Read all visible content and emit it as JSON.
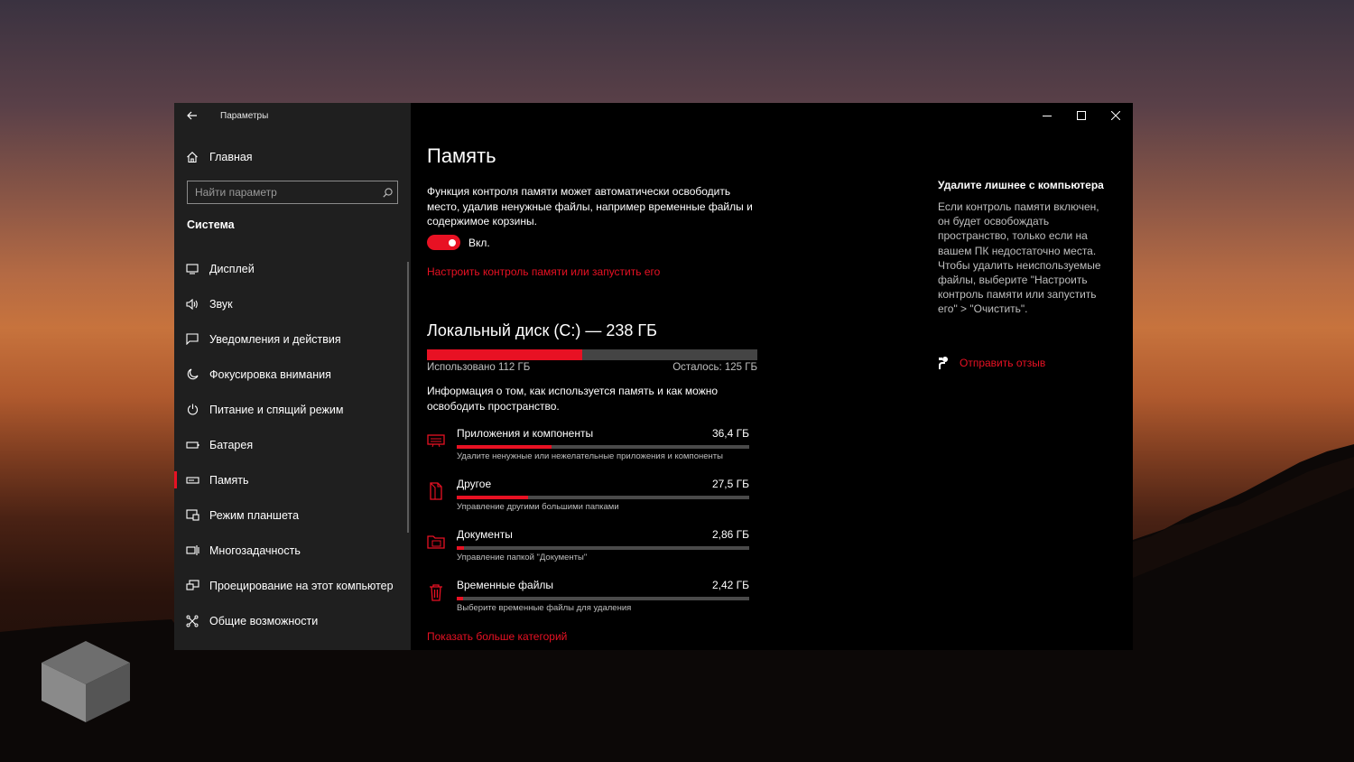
{
  "app_title": "Параметры",
  "sidebar": {
    "home_label": "Главная",
    "search_placeholder": "Найти параметр",
    "section_title": "Система",
    "items": [
      {
        "label": "Дисплей",
        "icon": "monitor-icon"
      },
      {
        "label": "Звук",
        "icon": "speaker-icon"
      },
      {
        "label": "Уведомления и действия",
        "icon": "notification-icon"
      },
      {
        "label": "Фокусировка внимания",
        "icon": "moon-icon"
      },
      {
        "label": "Питание и спящий режим",
        "icon": "power-icon"
      },
      {
        "label": "Батарея",
        "icon": "battery-icon"
      },
      {
        "label": "Память",
        "icon": "storage-icon",
        "active": true
      },
      {
        "label": "Режим планшета",
        "icon": "tablet-icon"
      },
      {
        "label": "Многозадачность",
        "icon": "multitasking-icon"
      },
      {
        "label": "Проецирование на этот компьютер",
        "icon": "projecting-icon"
      },
      {
        "label": "Общие возможности",
        "icon": "shared-experiences-icon"
      }
    ]
  },
  "main": {
    "title": "Память",
    "description": "Функция контроля памяти может автоматически освободить место, удалив ненужные файлы, например временные файлы и содержимое корзины.",
    "toggle": {
      "state": "on",
      "label": "Вкл."
    },
    "configure_link": "Настроить контроль памяти или запустить его",
    "disk": {
      "title": "Локальный диск (C:) — 238 ГБ",
      "used_label": "Использовано 112 ГБ",
      "free_label": "Осталось: 125 ГБ",
      "used_fraction": 0.47
    },
    "info": "Информация о том, как используется память и как можно освободить пространство.",
    "categories": [
      {
        "name": "Приложения и компоненты",
        "size": "36,4 ГБ",
        "sub": "Удалите ненужные или нежелательные приложения и компоненты",
        "fraction": 0.325,
        "icon": "apps-icon"
      },
      {
        "name": "Другое",
        "size": "27,5 ГБ",
        "sub": "Управление другими большими папками",
        "fraction": 0.245,
        "icon": "other-files-icon"
      },
      {
        "name": "Документы",
        "size": "2,86 ГБ",
        "sub": "Управление папкой \"Документы\"",
        "fraction": 0.026,
        "icon": "documents-folder-icon"
      },
      {
        "name": "Временные файлы",
        "size": "2,42 ГБ",
        "sub": "Выберите временные файлы для удаления",
        "fraction": 0.022,
        "icon": "trash-icon"
      }
    ],
    "more_link": "Показать больше категорий"
  },
  "aside": {
    "title": "Удалите лишнее с компьютера",
    "text": "Если контроль памяти включен, он будет освобождать пространство, только если на вашем ПК недостаточно места. Чтобы удалить неиспользуемые файлы, выберите \"Настроить контроль памяти или запустить его\" > \"Очистить\".",
    "feedback_label": "Отправить отзыв"
  },
  "colors": {
    "accent": "#e81123",
    "sidebar_bg": "#1f1f1f",
    "content_bg": "#000000"
  }
}
